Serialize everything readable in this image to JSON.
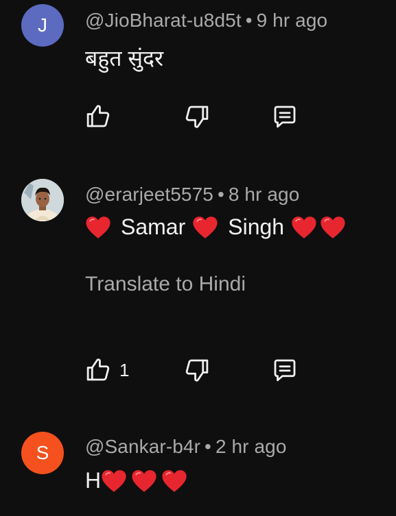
{
  "comments": [
    {
      "avatar_letter": "J",
      "avatar_color": "#5c6bc0",
      "username": "@JioBharat-u8d5t",
      "separator": "•",
      "time": "9 hr ago",
      "text": "बहुत सुंदर",
      "like_count": ""
    },
    {
      "avatar_letter": "",
      "avatar_color": "#c9d4d8",
      "username": "@erarjeet5575",
      "separator": "•",
      "time": "8 hr ago",
      "text_parts": [
        "Samar",
        "Singh"
      ],
      "translate_label": "Translate to Hindi",
      "like_count": "1"
    },
    {
      "avatar_letter": "S",
      "avatar_color": "#f4511e",
      "username": "@Sankar-b4r",
      "separator": "•",
      "time": "2 hr ago",
      "text_prefix": "H"
    }
  ],
  "icons": {
    "like": "thumb-up-icon",
    "dislike": "thumb-down-icon",
    "reply": "reply-comment-icon",
    "heart": "red-heart-emoji"
  },
  "colors": {
    "background": "#0f0f0f",
    "meta_text": "#aaaaaa",
    "heart": "#e8262f"
  }
}
